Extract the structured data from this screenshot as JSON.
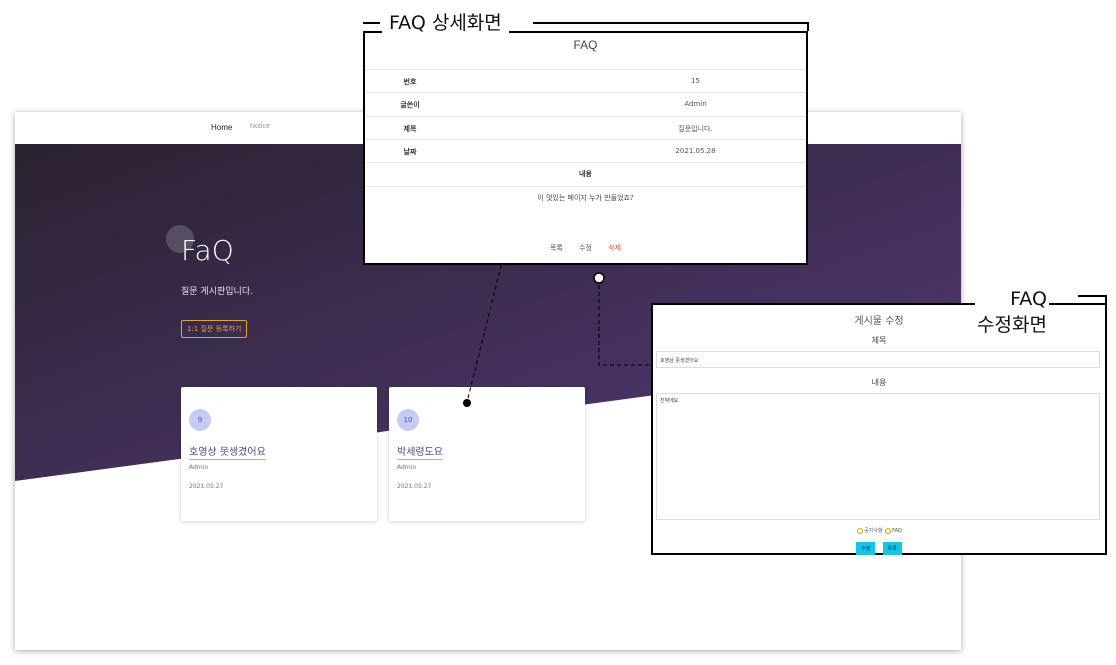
{
  "site": {
    "nav": {
      "home": "Home",
      "notice": "Notice"
    },
    "hero": {
      "title": "FaQ",
      "subtitle": "질문 게시판입니다.",
      "button": "1:1 질문 등록하기"
    },
    "cards": [
      {
        "num": "9",
        "title": "호영상 못생겼어요",
        "author": "Admin",
        "date": "2021.05.27"
      },
      {
        "num": "10",
        "title": "박세령도요",
        "author": "Admin",
        "date": "2021.05.27"
      }
    ]
  },
  "callouts": {
    "detail": "FAQ 상세화면",
    "edit_line1": "FAQ",
    "edit_line2": "수정화면"
  },
  "detail": {
    "heading": "FAQ",
    "rows": [
      {
        "label": "번호",
        "value": "15"
      },
      {
        "label": "글쓴이",
        "value": "Admin"
      },
      {
        "label": "제목",
        "value": "질문입니다."
      },
      {
        "label": "날짜",
        "value": "2021.05.28"
      }
    ],
    "content_label": "내용",
    "content": "이 멋있는 페이지 누가 만들었죠?",
    "actions": {
      "list": "목록",
      "edit": "수정",
      "delete": "삭제"
    }
  },
  "edit": {
    "heading": "게시물 수정",
    "title_label": "제목",
    "title_value": "호영상 못생겼어요",
    "content_label": "내용",
    "content_value": "진짜에요",
    "radio1": "공지사항",
    "radio2": "FAQ",
    "btn_edit": "수정",
    "btn_list": "목록"
  },
  "colors": {
    "hero_dark": "#2b2230",
    "hero_purple": "#533a78",
    "accent_orange": "#e0a437",
    "cyan_button": "#19c3e6",
    "delete_red": "#e24a4a"
  }
}
